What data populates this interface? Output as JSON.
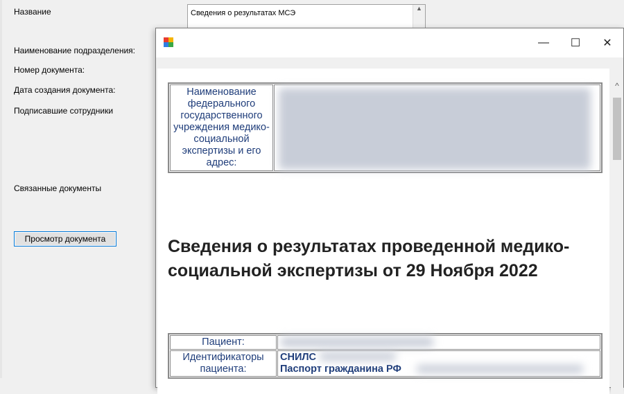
{
  "form": {
    "labels": {
      "name": "Название",
      "division": "Наименование подразделения:",
      "doc_number": "Номер документа:",
      "created": "Дата создания документа:",
      "signers": "Подписавшие сотрудники",
      "related": "Связанные документы"
    },
    "name_value": "Сведения о результатах МСЭ",
    "view_button": "Просмотр документа"
  },
  "viewer": {
    "title": "",
    "controls": {
      "minimize": "—",
      "maximize": "☐",
      "close": "✕"
    },
    "institution_label": "Наименование федерального государственного учреждения медико-социальной экспертизы и его адрес:",
    "heading": "Сведения о результатах проведенной медико-социальной экспертизы от 29 Ноября 2022",
    "patient_table": {
      "patient_label": "Пациент:",
      "ids_label": "Идентификаторы пациента:",
      "snils_label": "СНИЛС",
      "passport_label": "Паспорт гражданина РФ"
    }
  },
  "colors": {
    "accent": "#0078d7",
    "label_text": "#1f3d7a",
    "border": "#8a8a8a"
  }
}
